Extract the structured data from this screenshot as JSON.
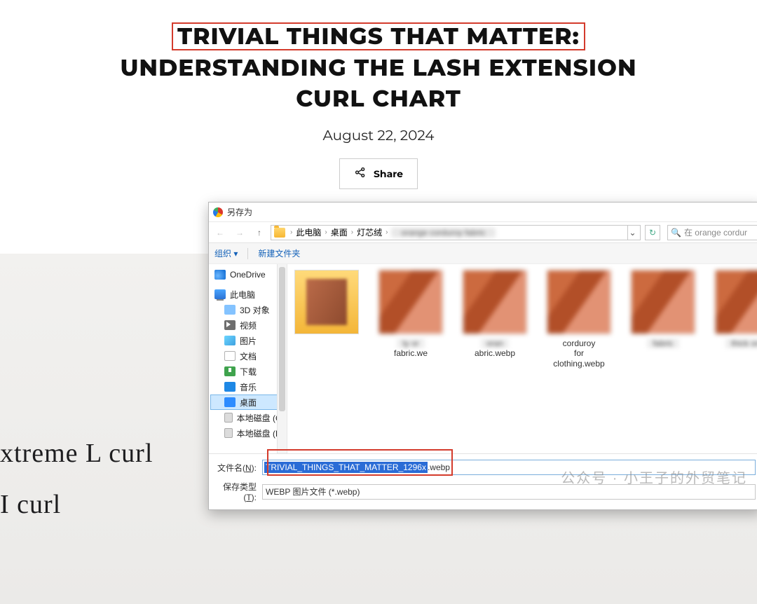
{
  "article": {
    "title_highlight": "TRIVIAL THINGS THAT MATTER:",
    "title_line2": "UNDERSTANDING THE LASH EXTENSION",
    "title_line3": "CURL CHART",
    "date": "August 22, 2024",
    "share_label": "Share",
    "serif_a": "xtreme L curl",
    "serif_b": "I curl"
  },
  "dialog": {
    "title": "另存为",
    "nav_back": "←",
    "nav_fwd": "→",
    "nav_up": "↑",
    "breadcrumb": [
      "此电脑",
      "桌面",
      "灯芯绒"
    ],
    "breadcrumb_blur": "orange corduroy fabric",
    "refresh": "↻",
    "search_placeholder": "在 orange cordur",
    "toolbar": {
      "organize": "组织 ▾",
      "newfolder": "新建文件夹"
    },
    "tree": {
      "onedrive": "OneDrive",
      "pc": "此电脑",
      "obj3d": "3D 对象",
      "video": "视频",
      "images": "图片",
      "docs": "文档",
      "downloads": "下载",
      "music": "音乐",
      "desktop": "桌面",
      "drive_c": "本地磁盘 (C:)",
      "drive_d": "本地磁盘 (D:)"
    },
    "thumbs": [
      {
        "caption_blur": "ty or",
        "caption2": "fabric.we"
      },
      {
        "caption_blur": "oran",
        "caption2": "abric.webp"
      },
      {
        "caption_top": "corduroy",
        "caption_mid": "for",
        "caption2": "clothing.webp"
      },
      {
        "caption_blur": "fabric",
        "caption2": ""
      },
      {
        "caption_blur": "thick ora",
        "caption2": ""
      }
    ],
    "fields": {
      "name_label": "文件名(",
      "name_accel": "N",
      "name_label_end": "):",
      "name_selected": "TRIVIAL_THINGS_THAT_MATTER_1296x",
      "name_rest": ".webp",
      "type_label": "保存类型(",
      "type_accel": "T",
      "type_label_end": "):",
      "type_value": "WEBP 图片文件 (*.webp)"
    }
  },
  "watermark": "公众号 · 小王子的外贸笔记"
}
